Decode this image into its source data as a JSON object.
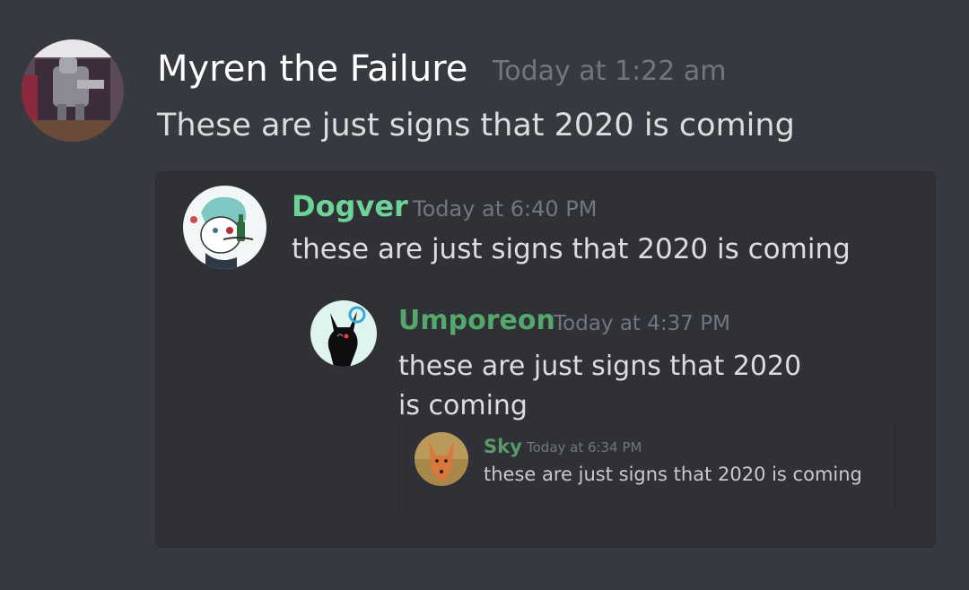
{
  "message": {
    "author": "Myren the Failure",
    "timestamp": "Today at 1:22 am",
    "content": "These are just signs that 2020 is coming",
    "avatar_icon": "avatar-robot-figure"
  },
  "quotes": [
    {
      "author": "Dogver",
      "timestamp": "Today at 6:40 PM",
      "content": "these are just signs that 2020 is coming",
      "name_color": "#6ed396",
      "avatar_icon": "avatar-cartoon-dog-with-wine"
    },
    {
      "author": "Umporeon",
      "timestamp": "Today at 4:37 PM",
      "content": "these are just signs that 2020 is coming",
      "name_color": "#54a86b",
      "avatar_icon": "avatar-umbreon-silhouette"
    },
    {
      "author": "Sky",
      "timestamp": "Today at 6:34 PM",
      "content": "these are just signs that 2020 is coming",
      "name_color": "#5a9a6a",
      "avatar_icon": "avatar-fox-photo"
    }
  ],
  "colors": {
    "background": "#36393f",
    "embed_background": "#2f3136",
    "timestamp": "#72767d"
  }
}
